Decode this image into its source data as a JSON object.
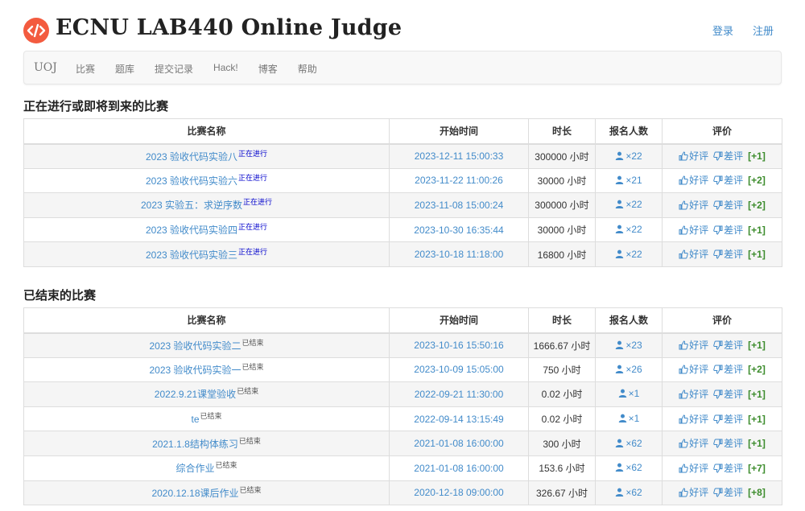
{
  "site": {
    "title": "ECNU LAB440 Online Judge",
    "login_label": "登录",
    "register_label": "注册",
    "logo_icon": "code-icon",
    "accent": "#f35b3f"
  },
  "nav": {
    "brand": "UOJ",
    "items": [
      "比赛",
      "题库",
      "提交记录",
      "Hack!",
      "博客",
      "帮助"
    ]
  },
  "columns": {
    "name": "比赛名称",
    "start": "开始时间",
    "duration": "时长",
    "registrants": "报名人数",
    "rating": "评价"
  },
  "rating_labels": {
    "good": "好评",
    "bad": "差评"
  },
  "sections": {
    "upcoming": {
      "title": "正在进行或即将到来的比赛",
      "rows": [
        {
          "name": "2023 验收代码实验八",
          "status": "正在进行",
          "start": "2023-12-11 15:00:33",
          "duration": "300000 小时",
          "registrants": "×22",
          "score": "[+1]"
        },
        {
          "name": "2023 验收代码实验六",
          "status": "正在进行",
          "start": "2023-11-22 11:00:26",
          "duration": "30000 小时",
          "registrants": "×21",
          "score": "[+2]"
        },
        {
          "name": "2023 实验五：求逆序数",
          "status": "正在进行",
          "start": "2023-11-08 15:00:24",
          "duration": "300000 小时",
          "registrants": "×22",
          "score": "[+2]"
        },
        {
          "name": "2023 验收代码实验四",
          "status": "正在进行",
          "start": "2023-10-30 16:35:44",
          "duration": "30000 小时",
          "registrants": "×22",
          "score": "[+1]"
        },
        {
          "name": "2023 验收代码实验三",
          "status": "正在进行",
          "start": "2023-10-18 11:18:00",
          "duration": "16800 小时",
          "registrants": "×22",
          "score": "[+1]"
        }
      ]
    },
    "ended": {
      "title": "已结束的比赛",
      "rows": [
        {
          "name": "2023 验收代码实验二",
          "status": "已结束",
          "start": "2023-10-16 15:50:16",
          "duration": "1666.67 小时",
          "registrants": "×23",
          "score": "[+1]"
        },
        {
          "name": "2023 验收代码实验一",
          "status": "已结束",
          "start": "2023-10-09 15:05:00",
          "duration": "750 小时",
          "registrants": "×26",
          "score": "[+2]"
        },
        {
          "name": "2022.9.21课堂验收",
          "status": "已结束",
          "start": "2022-09-21 11:30:00",
          "duration": "0.02 小时",
          "registrants": "×1",
          "score": "[+1]"
        },
        {
          "name": "te",
          "status": "已结束",
          "start": "2022-09-14 13:15:49",
          "duration": "0.02 小时",
          "registrants": "×1",
          "score": "[+1]"
        },
        {
          "name": "2021.1.8结构体练习",
          "status": "已结束",
          "start": "2021-01-08 16:00:00",
          "duration": "300 小时",
          "registrants": "×62",
          "score": "[+1]"
        },
        {
          "name": "综合作业",
          "status": "已结束",
          "start": "2021-01-08 16:00:00",
          "duration": "153.6 小时",
          "registrants": "×62",
          "score": "[+7]"
        },
        {
          "name": "2020.12.18课后作业",
          "status": "已结束",
          "start": "2020-12-18 09:00:00",
          "duration": "326.67 小时",
          "registrants": "×62",
          "score": "[+8]"
        }
      ]
    }
  }
}
